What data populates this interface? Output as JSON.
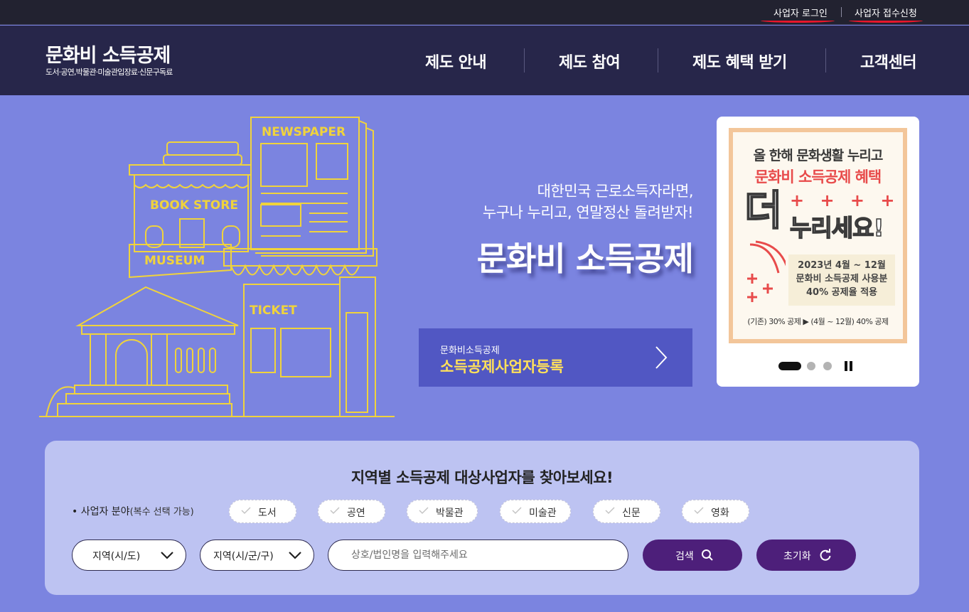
{
  "top_links": {
    "login": "사업자 로그인",
    "apply": "사업자 접수신청"
  },
  "logo": {
    "title": "문화비 소득공제",
    "subtitle": "도서·공연,박물관·미술관입장료·신문구독료"
  },
  "nav": [
    "제도 안내",
    "제도 참여",
    "제도 혜택 받기",
    "고객센터"
  ],
  "hero": {
    "line1": "대한민국 근로소득자라면,",
    "line2": "누구나 누리고, 연말정산 돌려받자!",
    "title": "문화비 소득공제",
    "illustration_labels": {
      "newspaper": "NEWSPAPER",
      "bookstore": "BOOK STORE",
      "museum": "MUSEUM",
      "ticket": "TICKET"
    },
    "register_button": {
      "small": "문화비소득공제",
      "big": "소득공제사업자등록"
    }
  },
  "banner": {
    "line1": "올 한해 문화생활 누리고",
    "line2": "문화비 소득공제 혜택",
    "deo": "더",
    "plus": "+ + + +",
    "nurise": "누리세요!",
    "info1": "2023년 4월 ~ 12월",
    "info2": "문화비 소득공제 사용분",
    "info3": "40% 공제율 적용",
    "footer": "(기존) 30% 공제 ▶ (4월 ~ 12월) 40% 공제"
  },
  "search": {
    "title": "지역별 소득공제 대상사업자를 찾아보세요!",
    "field_label": "• 사업자 분야",
    "field_note": "(복수 선택 가능)",
    "categories": [
      "도서",
      "공연",
      "박물관",
      "미술관",
      "신문",
      "영화"
    ],
    "region_sido": "지역(시/도)",
    "region_sigungu": "지역(시/군/구)",
    "placeholder": "상호/법인명을 입력해주세요",
    "search_label": "검색",
    "reset_label": "초기화"
  },
  "colors": {
    "page_bg": "#7b84e0",
    "header_bg": "#27264a",
    "accent_yellow": "#ffe05a",
    "button_purple": "#4d1f7a",
    "illustration_line": "#f0d33c"
  }
}
